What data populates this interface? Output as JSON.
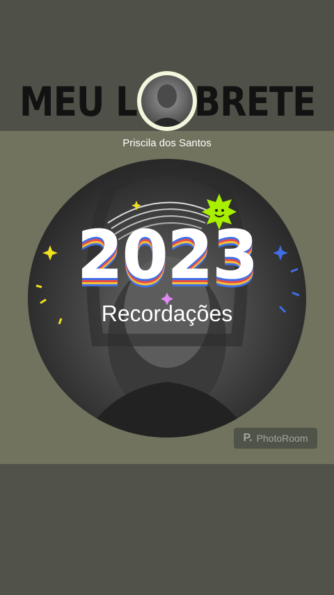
{
  "banner": {
    "text": "MEU LEMBRETE"
  },
  "profile": {
    "name": "Priscila dos Santos"
  },
  "story": {
    "year": "2023",
    "title": "Recordações"
  },
  "watermark": {
    "text": "PhotoRoom"
  },
  "colors": {
    "accent_blue": "#3f6fe6",
    "accent_red": "#e84a4a",
    "accent_yellow": "#f0c23a",
    "sun_green": "#a8f000"
  }
}
